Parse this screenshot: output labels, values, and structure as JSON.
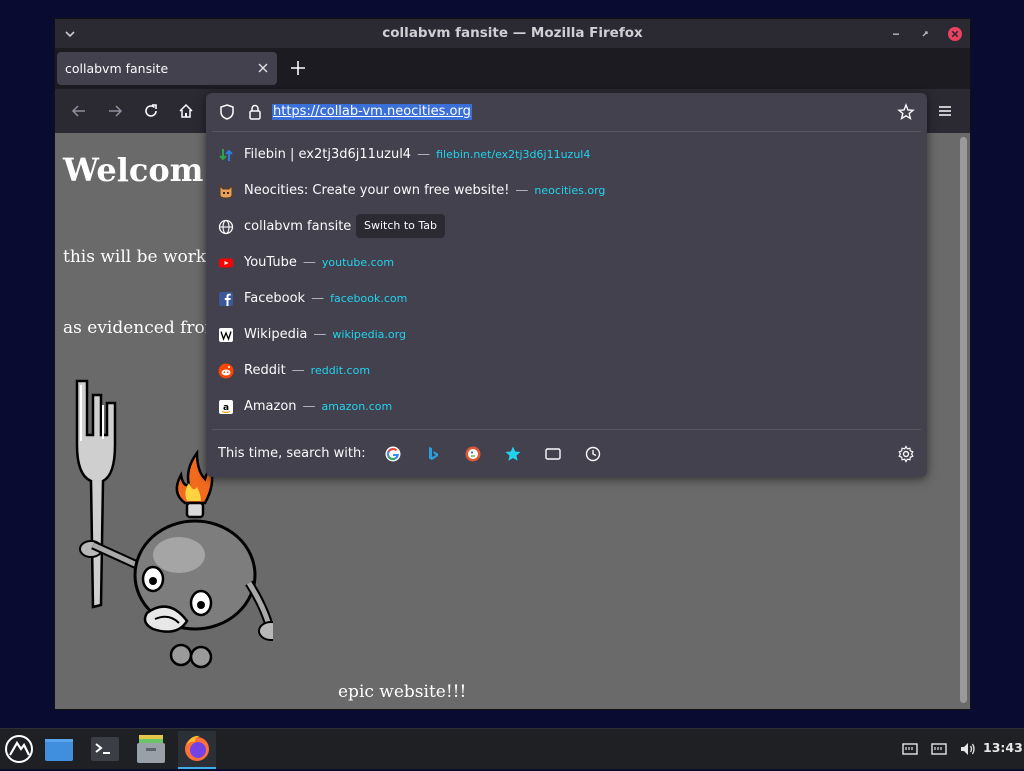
{
  "window": {
    "title": "collabvm fansite — Mozilla Firefox"
  },
  "tabs": [
    {
      "label": "collabvm fansite"
    }
  ],
  "urlbar": {
    "url": "https://collab-vm.neocities.org"
  },
  "suggestions": [
    {
      "title": "Filebin | ex2tj3d6j11uzul4",
      "url": "filebin.net/ex2tj3d6j11uzul4",
      "icon": "filebin-icon"
    },
    {
      "title": "Neocities: Create your own free website!",
      "url": "neocities.org",
      "icon": "neocities-cat-icon"
    },
    {
      "title": "collabvm fansite",
      "action": "Switch to Tab",
      "icon": "globe-icon"
    },
    {
      "title": "YouTube",
      "url": "youtube.com",
      "icon": "youtube-icon"
    },
    {
      "title": "Facebook",
      "url": "facebook.com",
      "icon": "facebook-icon"
    },
    {
      "title": "Wikipedia",
      "url": "wikipedia.org",
      "icon": "wikipedia-icon"
    },
    {
      "title": "Reddit",
      "url": "reddit.com",
      "icon": "reddit-icon"
    },
    {
      "title": "Amazon",
      "url": "amazon.com",
      "icon": "amazon-icon"
    }
  ],
  "search_with": {
    "label": "This time, search with:",
    "engines": [
      "google-icon",
      "bing-icon",
      "duckduckgo-icon",
      "bookmarks-star-icon",
      "tabs-icon",
      "history-icon"
    ]
  },
  "page": {
    "heading": "Welcom",
    "line1": "this will be worke",
    "line2": "as evidenced fron",
    "footer": "epic website!!!"
  },
  "taskbar": {
    "clock": "13:43"
  },
  "colors": {
    "accent_link": "#22d3ee",
    "selection": "#3a6fd8",
    "panel": "#42414d",
    "page_bg": "#6a6a6a"
  }
}
